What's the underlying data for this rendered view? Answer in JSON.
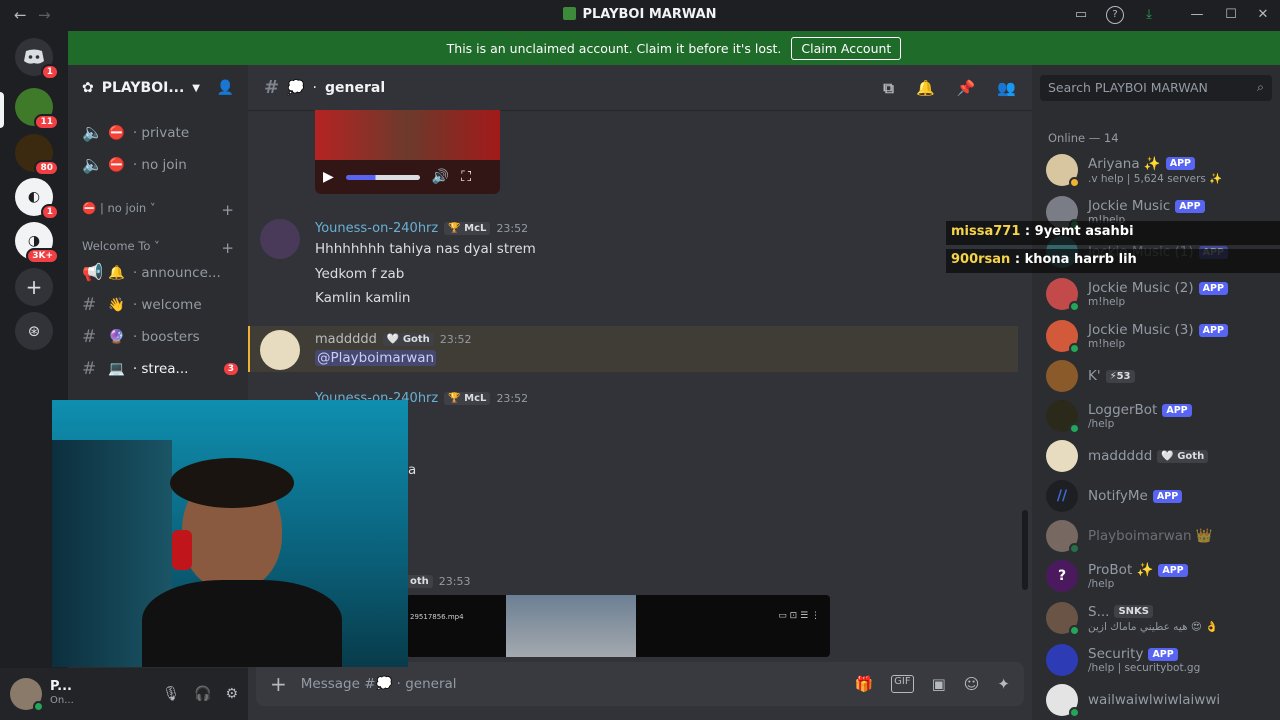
{
  "window": {
    "title": "PLAYBOI MARWAN"
  },
  "banner": {
    "text": "This is an unclaimed account. Claim it before it's lost.",
    "button": "Claim Account"
  },
  "guilds": {
    "home_badge": "1",
    "items": [
      {
        "badge": "11"
      },
      {
        "badge": "80"
      },
      {
        "badge": "1"
      },
      {
        "badge": "3K+"
      }
    ]
  },
  "server": {
    "name": "PLAYBOI..."
  },
  "channels": {
    "c1": "· private",
    "c2": "· no join",
    "cat1": "| no join",
    "cat2": "Welcome To",
    "c3": "· announce...",
    "c4": "· welcome",
    "c5": "· boosters",
    "c6": "· strea...",
    "c6_badge": "3"
  },
  "user_panel": {
    "name": "P...",
    "status": "On..."
  },
  "chat": {
    "channel": "general",
    "messages": [
      {
        "author": "Youness-on-240hrz",
        "tag": "McL",
        "time": "23:52",
        "lines": [
          "Hhhhhhhh tahiya nas dyal strem",
          "Yedkom f zab",
          "Kamlin kamlin"
        ]
      },
      {
        "author": "maddddd",
        "tag": "Goth",
        "time": "23:52",
        "mention": "@Playboimarwan"
      },
      {
        "author": "Youness-on-240hrz",
        "tag": "McL",
        "time": "23:52",
        "partial": "a"
      },
      {
        "tag": "oth",
        "time": "23:53",
        "file": "29517856.mp4"
      }
    ],
    "placeholder": "Message #💭 · general"
  },
  "members": {
    "search_placeholder": "Search PLAYBOI MARWAN",
    "group": "Online — 14",
    "list": [
      {
        "name": "Ariyana ✨",
        "app": "APP",
        "sub": ".v help | 5,624 servers ✨"
      },
      {
        "name": "Jockie Music",
        "app": "APP",
        "sub": "m!help"
      },
      {
        "name": "Jockie Music (1)",
        "app": "APP",
        "sub": ""
      },
      {
        "name": "Jockie Music (2)",
        "app": "APP",
        "sub": "m!help"
      },
      {
        "name": "Jockie Music (3)",
        "app": "APP",
        "sub": "m!help"
      },
      {
        "name": "K'",
        "tag": "⚡53",
        "sub": ""
      },
      {
        "name": "LoggerBot",
        "app": "APP",
        "sub": "/help"
      },
      {
        "name": "maddddd",
        "tag": "Goth",
        "sub": ""
      },
      {
        "name": "NotifyMe",
        "app": "APP",
        "sub": ""
      },
      {
        "name": "Playboimarwan 👑",
        "sub": ""
      },
      {
        "name": "ProBot ✨",
        "app": "APP",
        "sub": "/help"
      },
      {
        "name": "S...",
        "tag": "SNKS",
        "sub": "هيه عطيني ماماك ازين 😍 👌"
      },
      {
        "name": "Security",
        "app": "APP",
        "sub": "/help | securitybot.gg"
      },
      {
        "name": "wailwaiwlwiwlaiwwi",
        "sub": ""
      }
    ]
  },
  "stream_chat": [
    {
      "user": "missa771",
      "text": ": 9yemt asahbi"
    },
    {
      "user": "900rsan",
      "text": ": khona harrb lih"
    }
  ],
  "colors": {
    "accent": "#5865f2",
    "online": "#23a55a",
    "mention": "#f23f43",
    "banner": "#1f6b2a"
  }
}
